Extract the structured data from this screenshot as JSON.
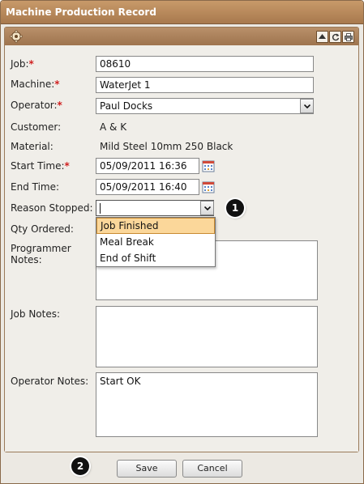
{
  "window": {
    "title": "Machine Production Record"
  },
  "form": {
    "job": {
      "label": "Job:",
      "value": "08610"
    },
    "machine": {
      "label": "Machine:",
      "value": "WaterJet 1"
    },
    "operator": {
      "label": "Operator:",
      "value": "Paul Docks"
    },
    "customer": {
      "label": "Customer:",
      "value": "A & K"
    },
    "material": {
      "label": "Material:",
      "value": "Mild Steel 10mm 250 Black"
    },
    "start_time": {
      "label": "Start Time:",
      "value": "05/09/2011 16:36"
    },
    "end_time": {
      "label": "End Time:",
      "value": "05/09/2011 16:40"
    },
    "reason_stopped": {
      "label": "Reason Stopped:",
      "value": "",
      "options": [
        "Job Finished",
        "Meal Break",
        "End of Shift"
      ],
      "highlighted": "Job Finished"
    },
    "qty_ordered": {
      "label": "Qty Ordered:"
    },
    "programmer_notes": {
      "label_line1": "Programmer",
      "label_line2": "Notes:",
      "value": ""
    },
    "job_notes": {
      "label": "Job Notes:",
      "value": ""
    },
    "operator_notes": {
      "label": "Operator Notes:",
      "value": "Start OK"
    },
    "required_mark": "*"
  },
  "markers": [
    "1",
    "2"
  ],
  "buttons": {
    "save": "Save",
    "cancel": "Cancel"
  },
  "icons": {
    "header": "gear-icon",
    "collapse": "collapse-icon",
    "refresh": "refresh-icon",
    "print": "print-icon",
    "calendar": "calendar-icon",
    "dropdown": "chevron-down-icon"
  },
  "colors": {
    "titlebar": "#b8895c",
    "required": "#d02020",
    "dropdown_highlight": "#fbd79a"
  }
}
